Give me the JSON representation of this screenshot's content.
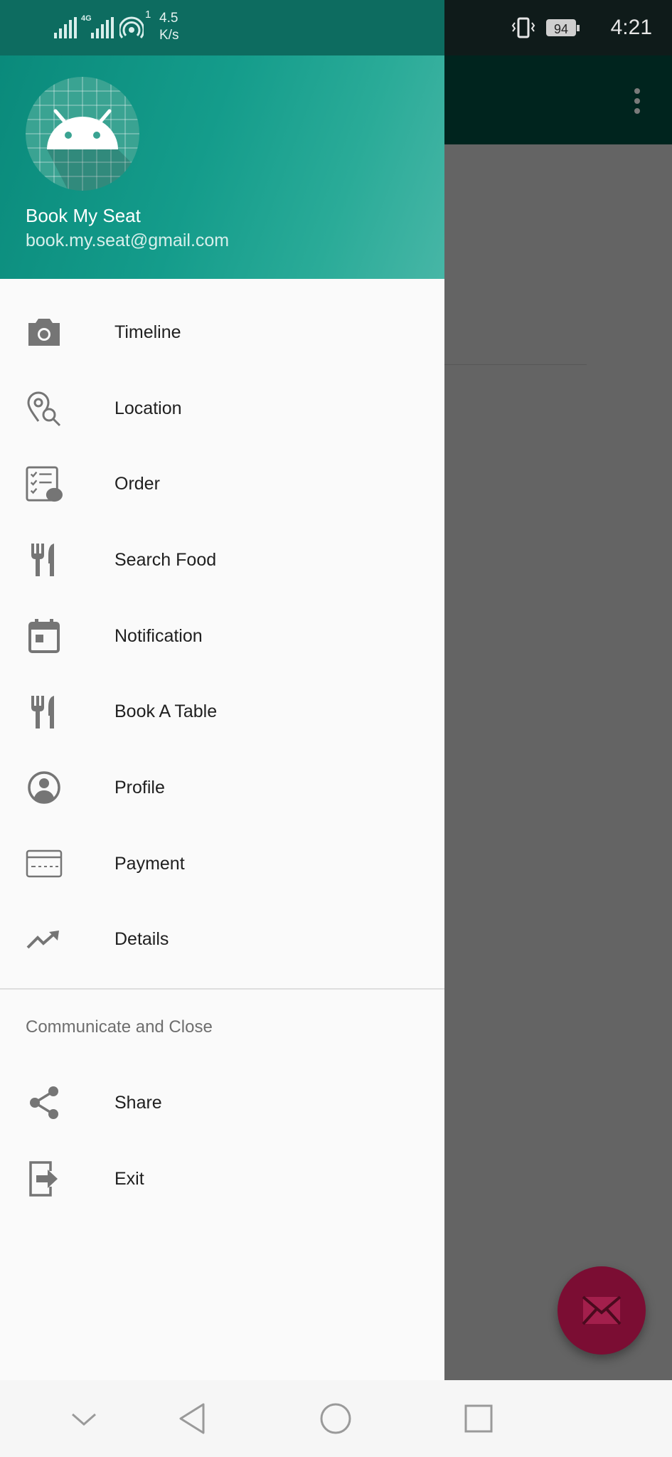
{
  "status_bar": {
    "network": "4G",
    "speed_value": "4.5",
    "speed_unit": "K/s",
    "speed_superscript": "1",
    "battery": "94",
    "time": "4:21"
  },
  "drawer": {
    "header": {
      "app_name": "Book My Seat",
      "email": "book.my.seat@gmail.com"
    },
    "items": [
      {
        "label": "Timeline",
        "icon": "camera-icon"
      },
      {
        "label": "Location",
        "icon": "location-search-icon"
      },
      {
        "label": "Order",
        "icon": "checklist-icon"
      },
      {
        "label": "Search Food",
        "icon": "restaurant-icon"
      },
      {
        "label": "Notification",
        "icon": "calendar-icon"
      },
      {
        "label": "Book A Table",
        "icon": "restaurant-icon"
      },
      {
        "label": "Profile",
        "icon": "account-circle-icon"
      },
      {
        "label": "Payment",
        "icon": "credit-card-icon"
      },
      {
        "label": "Details",
        "icon": "trending-up-icon"
      }
    ],
    "section_title": "Communicate and Close",
    "section_items": [
      {
        "label": "Share",
        "icon": "share-icon"
      },
      {
        "label": "Exit",
        "icon": "exit-icon"
      }
    ]
  },
  "colors": {
    "primary": "#009688",
    "primary_dark": "#00796b",
    "fab": "#7b0d33",
    "icon": "#757575"
  }
}
